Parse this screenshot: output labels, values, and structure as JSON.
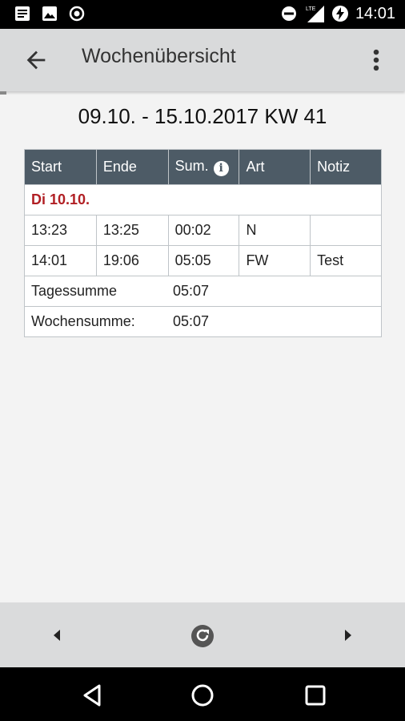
{
  "status_bar": {
    "time": "14:01",
    "left_icons": [
      "notes-icon",
      "image-icon",
      "radio-icon"
    ],
    "right_icons": [
      "dnd-icon",
      "lte-signal-icon",
      "battery-charging-icon"
    ],
    "network": "LTE"
  },
  "app_bar": {
    "title": "Wochenübersicht",
    "back_icon": "arrow-back-icon",
    "menu_icon": "more-vert-icon"
  },
  "week_heading": "09.10. - 15.10.2017 KW 41",
  "table": {
    "headers": [
      "Start",
      "Ende",
      "Sum.",
      "Art",
      "Notiz"
    ],
    "day": "Di 10.10.",
    "rows": [
      {
        "start": "13:23",
        "end": "13:25",
        "sum": "00:02",
        "type": "N",
        "note": ""
      },
      {
        "start": "14:01",
        "end": "19:06",
        "sum": "05:05",
        "type": "FW",
        "note": "Test"
      }
    ],
    "day_total_label": "Tagessumme",
    "day_total_value": "05:07",
    "week_total_label": "Wochensumme:",
    "week_total_value": "05:07"
  },
  "toolbar": {
    "prev_icon": "chevron-left-icon",
    "refresh_icon": "refresh-icon",
    "next_icon": "chevron-right-icon"
  },
  "nav_bar": {
    "icons": [
      "nav-back-icon",
      "nav-home-icon",
      "nav-recents-icon"
    ]
  },
  "colors": {
    "header_bg": "#4d5b66",
    "day_label": "#b11f24",
    "appbar_bg": "#d9dadb",
    "content_bg": "#f3f3f3"
  }
}
